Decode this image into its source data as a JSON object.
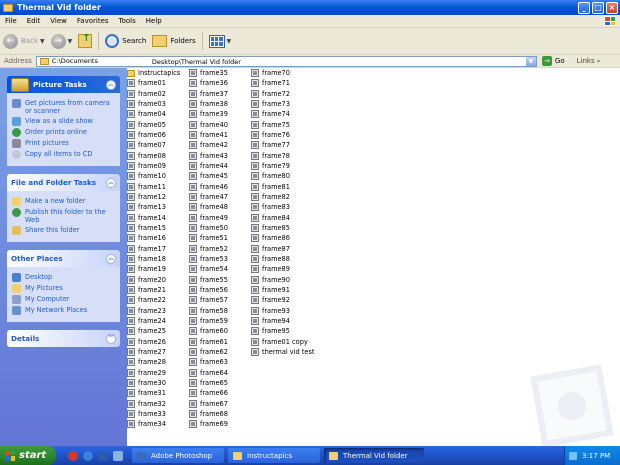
{
  "window": {
    "title": "Thermal Vid folder"
  },
  "menu": [
    "File",
    "Edit",
    "View",
    "Favorites",
    "Tools",
    "Help"
  ],
  "toolbar": {
    "back_label": "Back",
    "search_label": "Search",
    "folders_label": "Folders"
  },
  "address": {
    "label": "Address",
    "path_part1": "C:\\Documents",
    "path_part2": "Desktop\\Thermal Vid folder",
    "go_label": "Go",
    "links_label": "Links"
  },
  "left_pane": {
    "picture_tasks": {
      "title": "Picture Tasks",
      "items": [
        "Get pictures from camera or scanner",
        "View as a slide show",
        "Order prints online",
        "Print pictures",
        "Copy all items to CD"
      ]
    },
    "file_folder_tasks": {
      "title": "File and Folder Tasks",
      "items": [
        "Make a new folder",
        "Publish this folder to the Web",
        "Share this folder"
      ]
    },
    "other_places": {
      "title": "Other Places",
      "items": [
        "Desktop",
        "My Pictures",
        "My Computer",
        "My Network Places"
      ]
    },
    "details": {
      "title": "Details"
    }
  },
  "files": {
    "col1": [
      "Instructapics",
      "frame01",
      "frame02",
      "frame03",
      "frame04",
      "frame05",
      "frame06",
      "frame07",
      "frame08",
      "frame09",
      "frame10",
      "frame11",
      "frame12",
      "frame13",
      "frame14",
      "frame15",
      "frame16",
      "frame17",
      "frame18",
      "frame19",
      "frame20",
      "frame21",
      "frame22",
      "frame23",
      "frame24",
      "frame25",
      "frame26",
      "frame27",
      "frame28",
      "frame29",
      "frame30",
      "frame31",
      "frame32",
      "frame33",
      "frame34"
    ],
    "col2": [
      "frame35",
      "frame36",
      "frame37",
      "frame38",
      "frame39",
      "frame40",
      "frame41",
      "frame42",
      "frame43",
      "frame44",
      "frame45",
      "frame46",
      "frame47",
      "frame48",
      "frame49",
      "frame50",
      "frame51",
      "frame52",
      "frame53",
      "frame54",
      "frame55",
      "frame56",
      "frame57",
      "frame58",
      "frame59",
      "frame60",
      "frame61",
      "frame62",
      "frame63",
      "frame64",
      "frame65",
      "frame66",
      "frame67",
      "frame68",
      "frame69"
    ],
    "col3": [
      "frame70",
      "frame71",
      "frame72",
      "frame73",
      "frame74",
      "frame75",
      "frame76",
      "frame77",
      "frame78",
      "frame79",
      "frame80",
      "frame81",
      "frame82",
      "frame83",
      "frame84",
      "frame85",
      "frame86",
      "frame87",
      "frame88",
      "frame89",
      "frame90",
      "frame91",
      "frame92",
      "frame93",
      "frame94",
      "frame95",
      "frame01 copy",
      "thermal vid test"
    ]
  },
  "taskbar": {
    "start_label": "start",
    "tasks": [
      "Adobe Photoshop",
      "Instructapics",
      "Thermal Vid folder"
    ],
    "clock": "3:17 PM"
  },
  "colors": {
    "title_blue": "#0a5fd8",
    "pane_blue": "#7aa1e6",
    "taskbar_blue": "#245edb",
    "start_green": "#2b8a2b",
    "link_blue": "#215dc6"
  }
}
